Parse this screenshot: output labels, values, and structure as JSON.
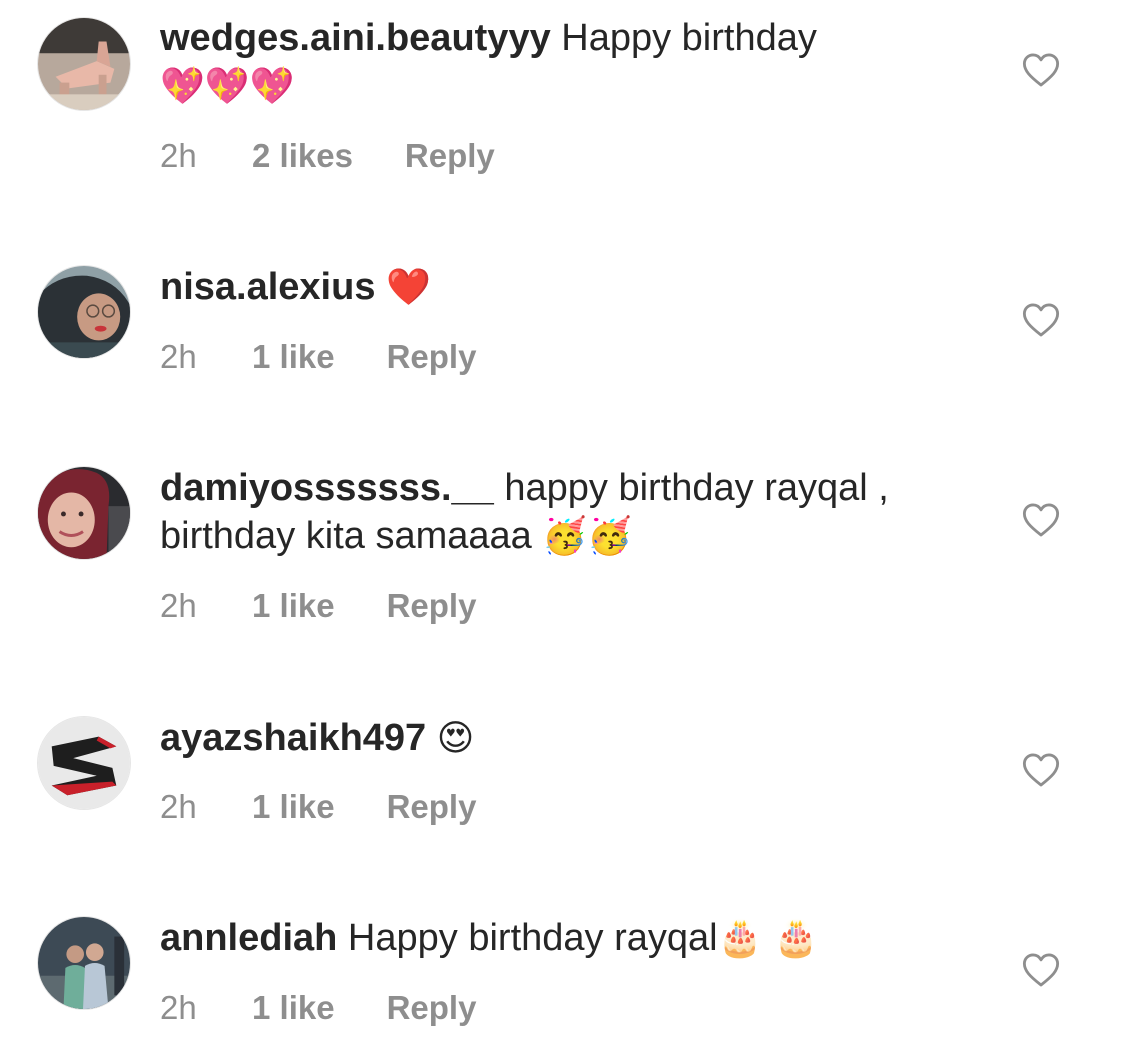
{
  "comments": [
    {
      "username": "wedges.aini.beautyyy",
      "text": " Happy birthday ",
      "emoji": "💖💖💖",
      "time": "2h",
      "likes": "2 likes",
      "reply": "Reply",
      "avatar_icon": "sandal-photo-avatar"
    },
    {
      "username": "nisa.alexius",
      "text": " ",
      "emoji": "❤️",
      "time": "2h",
      "likes": "1 like",
      "reply": "Reply",
      "avatar_icon": "person-hijab-photo-avatar"
    },
    {
      "username": "damiyosssssss.__",
      "text": " happy birthday rayqal , birthday kita samaaaa ",
      "emoji": "🥳🥳",
      "time": "2h",
      "likes": "1 like",
      "reply": "Reply",
      "avatar_icon": "person-red-hijab-photo-avatar"
    },
    {
      "username": "ayazshaikh497",
      "text": " ",
      "emoji": "😍",
      "time": "2h",
      "likes": "1 like",
      "reply": "Reply",
      "avatar_icon": "s-logo-avatar"
    },
    {
      "username": "annlediah",
      "text": " Happy birthday rayqal",
      "emoji": "🎂 🎂",
      "time": "2h",
      "likes": "1 like",
      "reply": "Reply",
      "avatar_icon": "two-people-photo-avatar"
    }
  ],
  "colors": {
    "text": "#262626",
    "meta": "#8e8e8e",
    "heart_outline": "#8e8e8e",
    "background": "#ffffff"
  },
  "icons": {
    "like": "heart-outline-icon"
  }
}
